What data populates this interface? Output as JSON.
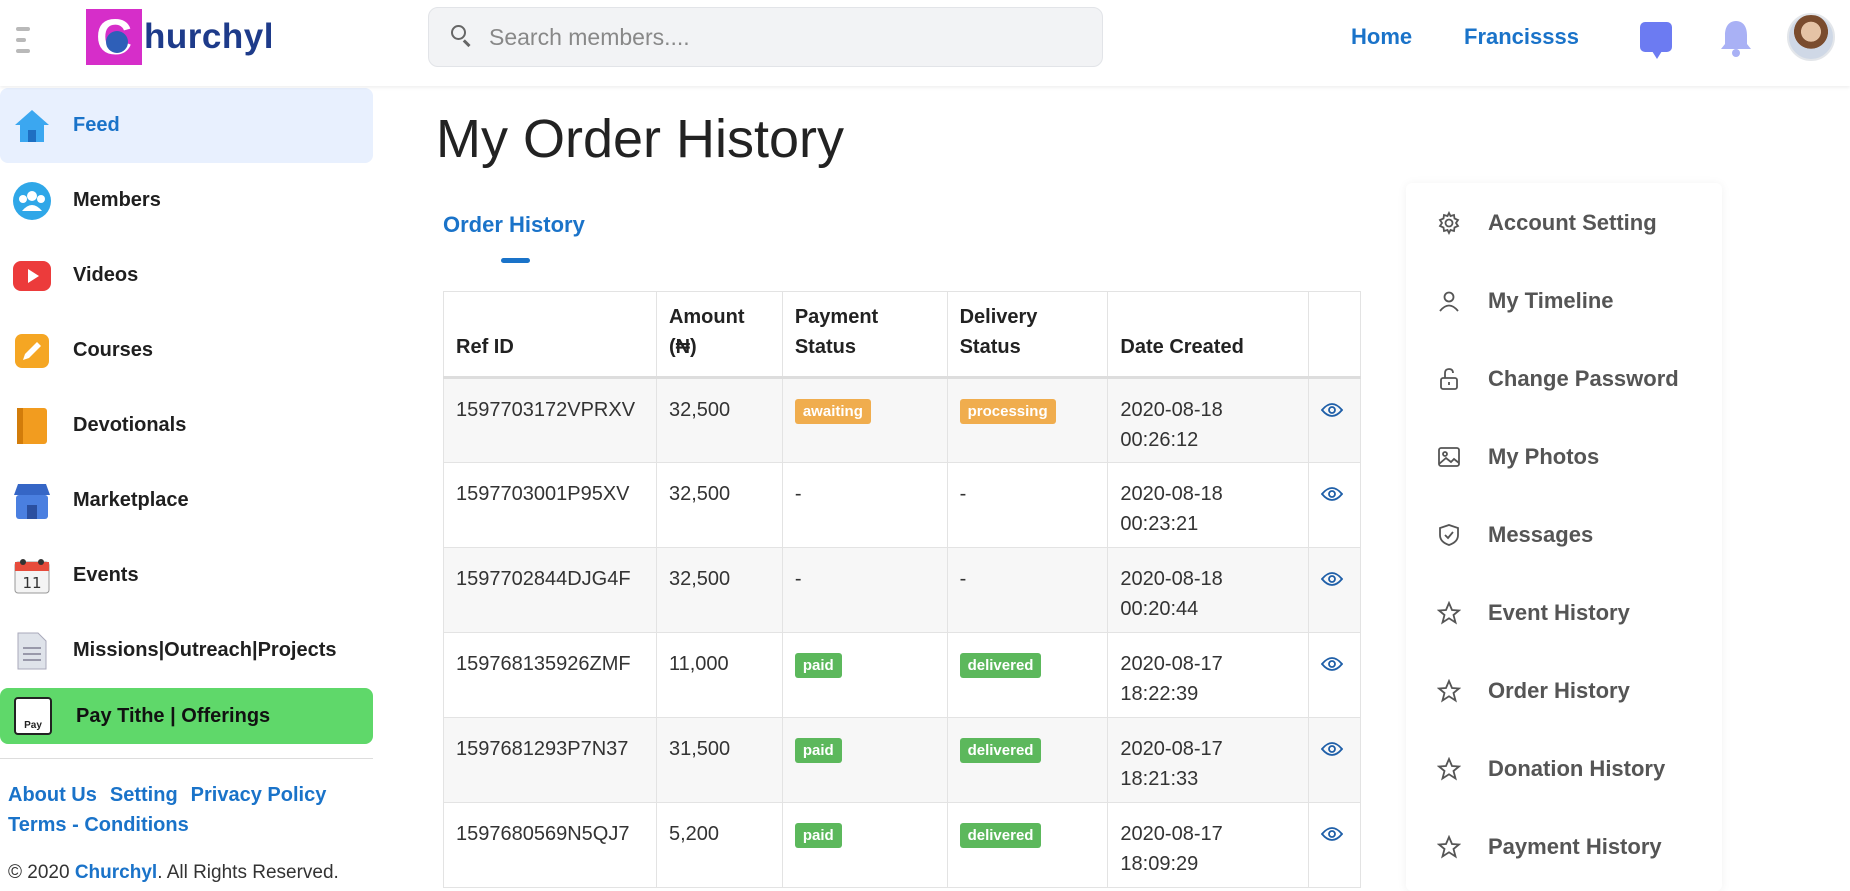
{
  "header": {
    "brand": "hurchyl",
    "brand_initial": "C",
    "search_placeholder": "Search members....",
    "nav": [
      {
        "label": "Home"
      },
      {
        "label": "Francissss"
      }
    ],
    "colors": {
      "accent": "#1a73c9",
      "brand_pink": "#d62ec9",
      "brand_blue": "#1e3b8a"
    }
  },
  "sidebar": {
    "items": [
      {
        "label": "Feed",
        "icon": "home-icon",
        "active": true
      },
      {
        "label": "Members",
        "icon": "members-icon"
      },
      {
        "label": "Videos",
        "icon": "video-play-icon"
      },
      {
        "label": "Courses",
        "icon": "pencil-icon"
      },
      {
        "label": "Devotionals",
        "icon": "book-icon"
      },
      {
        "label": "Marketplace",
        "icon": "store-icon"
      },
      {
        "label": "Events",
        "icon": "calendar-icon"
      },
      {
        "label": "Missions|Outreach|Projects",
        "icon": "document-icon"
      }
    ],
    "pay": {
      "label": "Pay Tithe | Offerings",
      "icon_text": "Pay",
      "color": "#5fd86a"
    },
    "footer_links": [
      "About Us",
      "Setting",
      "Privacy Policy",
      "Terms - Conditions"
    ],
    "copyright_prefix": "© 2020 ",
    "copyright_brand": "Churchyl",
    "copyright_suffix": ". All Rights Reserved."
  },
  "main": {
    "title": "My Order History",
    "tab": "Order History",
    "table": {
      "headers": [
        [
          "Ref ID"
        ],
        [
          "Amount",
          "(₦)"
        ],
        [
          "Payment",
          "Status"
        ],
        [
          "Delivery",
          "Status"
        ],
        [
          "Date Created"
        ],
        [
          ""
        ]
      ],
      "rows": [
        {
          "ref": "1597703172VPRXV",
          "amount": "32,500",
          "payment": "awaiting",
          "delivery": "processing",
          "date": "2020-08-18",
          "time": "00:26:12"
        },
        {
          "ref": "1597703001P95XV",
          "amount": "32,500",
          "payment": "-",
          "delivery": "-",
          "date": "2020-08-18",
          "time": "00:23:21"
        },
        {
          "ref": "1597702844DJG4F",
          "amount": "32,500",
          "payment": "-",
          "delivery": "-",
          "date": "2020-08-18",
          "time": "00:20:44"
        },
        {
          "ref": "159768135926ZMF",
          "amount": "11,000",
          "payment": "paid",
          "delivery": "delivered",
          "date": "2020-08-17",
          "time": "18:22:39"
        },
        {
          "ref": "1597681293P7N37",
          "amount": "31,500",
          "payment": "paid",
          "delivery": "delivered",
          "date": "2020-08-17",
          "time": "18:21:33"
        },
        {
          "ref": "1597680569N5QJ7",
          "amount": "5,200",
          "payment": "paid",
          "delivery": "delivered",
          "date": "2020-08-17",
          "time": "18:09:29"
        }
      ]
    }
  },
  "settings": {
    "items": [
      {
        "label": "Account Setting",
        "icon": "gear-icon"
      },
      {
        "label": "My Timeline",
        "icon": "user-icon"
      },
      {
        "label": "Change Password",
        "icon": "unlock-icon"
      },
      {
        "label": "My Photos",
        "icon": "image-icon"
      },
      {
        "label": "Messages",
        "icon": "shield-check-icon"
      },
      {
        "label": "Event History",
        "icon": "star-icon"
      },
      {
        "label": "Order History",
        "icon": "star-icon"
      },
      {
        "label": "Donation History",
        "icon": "star-icon"
      },
      {
        "label": "Payment History",
        "icon": "star-icon"
      }
    ]
  }
}
